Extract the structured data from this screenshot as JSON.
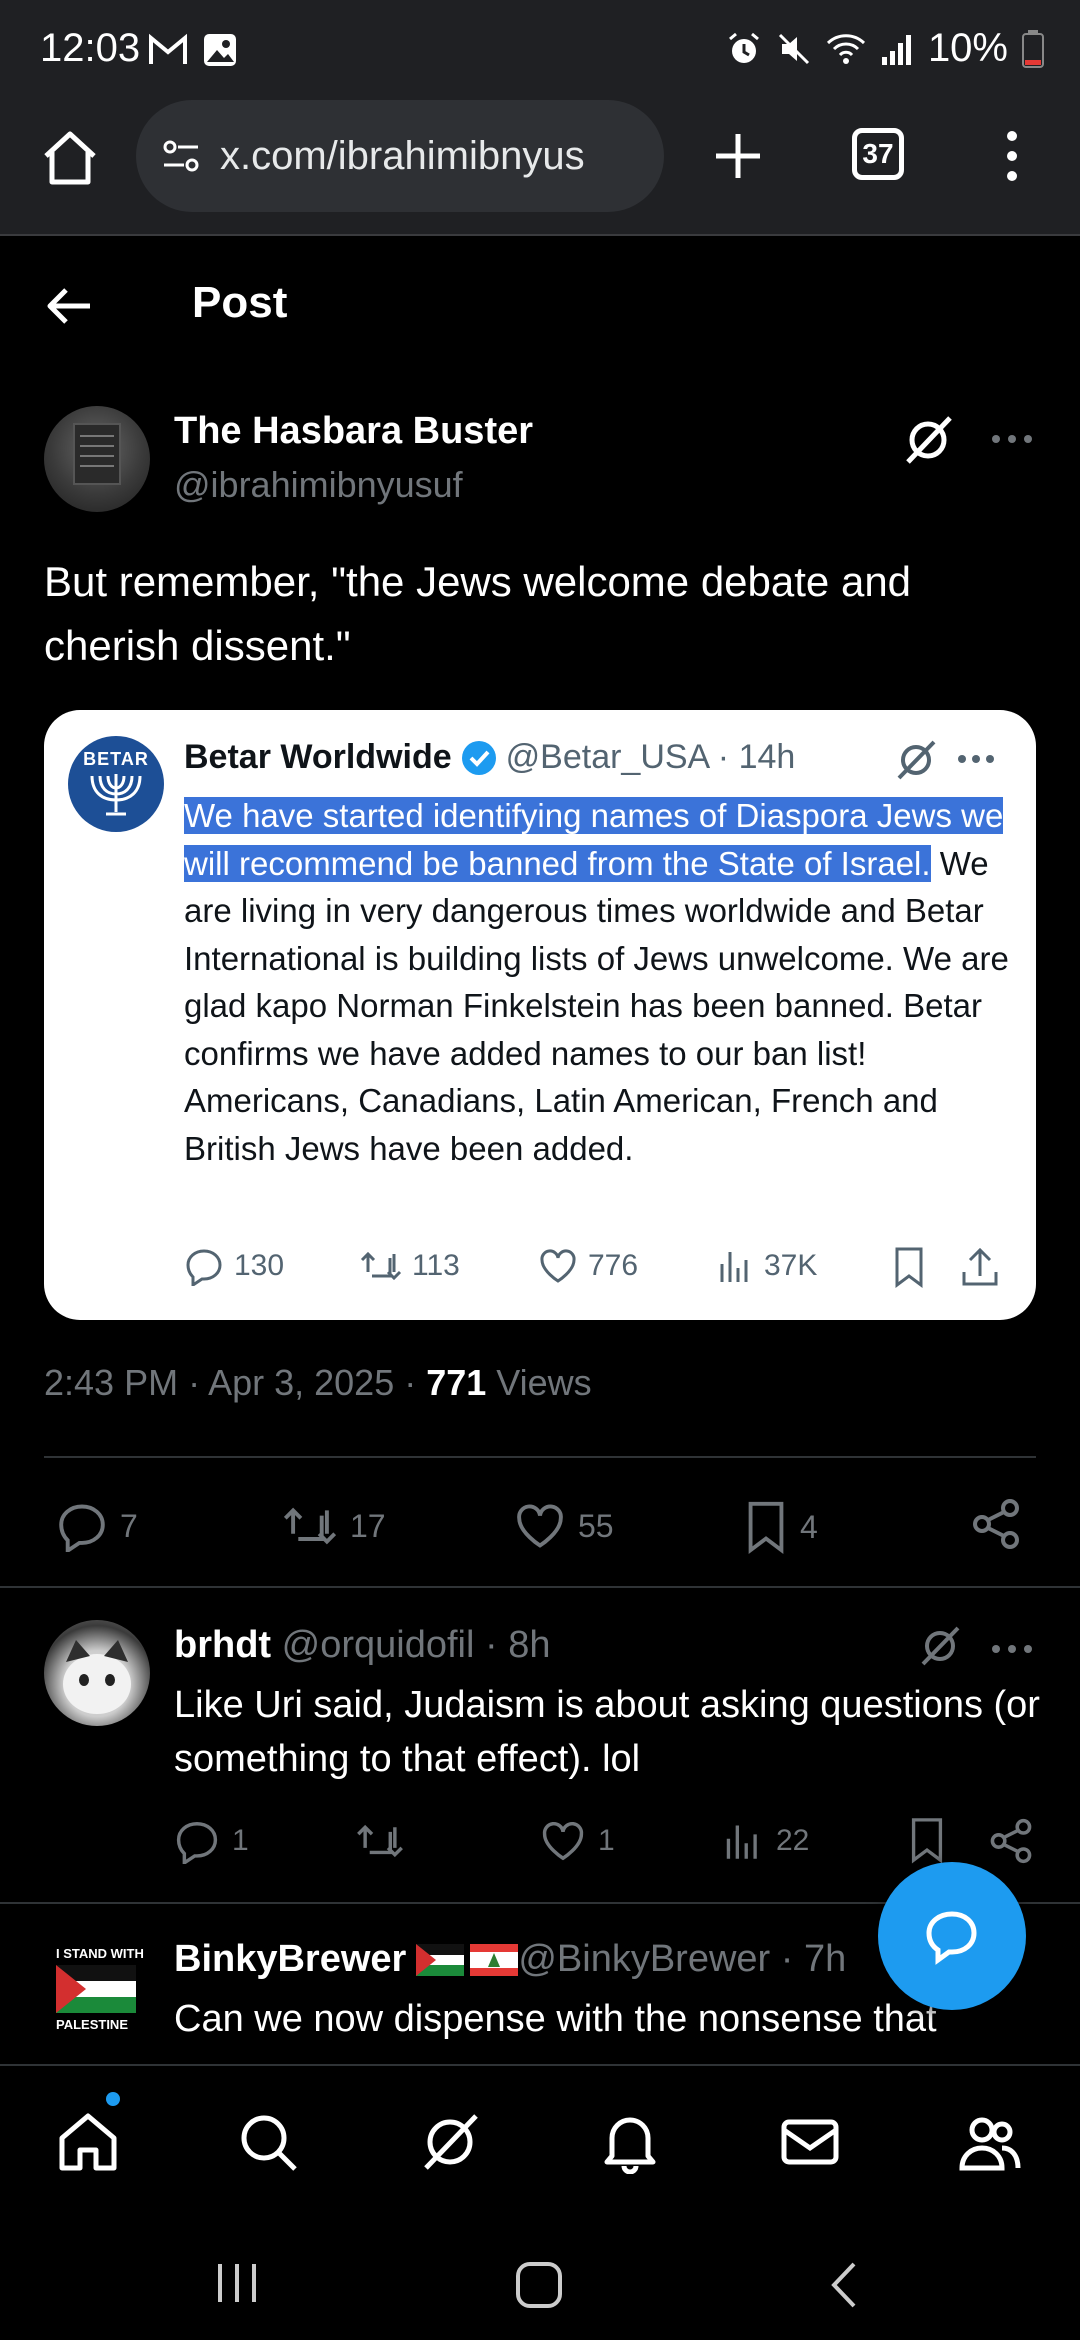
{
  "status_bar": {
    "time": "12:03",
    "battery": "10%"
  },
  "browser": {
    "url": "x.com/ibrahimibnyus",
    "tab_count": "37"
  },
  "header": {
    "title": "Post"
  },
  "post": {
    "author_name": "The Hasbara Buster",
    "author_handle": "@ibrahimibnyusuf",
    "text": "But remember, \"the Jews welcome debate and cherish dissent.\"",
    "time": "2:43 PM · Apr 3, 2025 · ",
    "views_count": "771",
    "views_label": " Views",
    "replies": "7",
    "reposts": "17",
    "likes": "55",
    "bookmarks": "4"
  },
  "quote": {
    "avatar_text": "BETAR",
    "name": "Betar Worldwide",
    "meta": "@Betar_USA · 14h",
    "highlighted_text": "We have started identifying names of Diaspora Jews we will recommend be banned from the State of Israel.",
    "rest_text": " We are living in very dangerous times worldwide and Betar International is building lists of Jews unwelcome. We are glad kapo Norman Finkelstein has been banned. Betar confirms we have added names to our ban list! Americans, Canadians, Latin American, French and British Jews have been added.",
    "replies": "130",
    "reposts": "113",
    "likes": "776",
    "views": "37K"
  },
  "replies": [
    {
      "name": "brhdt",
      "meta": " @orquidofil · 8h",
      "text": "Like Uri said, Judaism is about asking questions (or something to that effect). lol",
      "replies": "1",
      "likes": "1",
      "views": "22"
    },
    {
      "name": "BinkyBrewer",
      "meta": " @BinkyBrewer · 7h",
      "text": "Can we now dispense with the nonsense that",
      "avatar_text_top": "I STAND WITH",
      "avatar_text_bottom": "PALESTINE"
    }
  ],
  "colors": {
    "accent": "#1d9bf0",
    "highlight": "#3b73d9",
    "muted": "#71767b"
  }
}
